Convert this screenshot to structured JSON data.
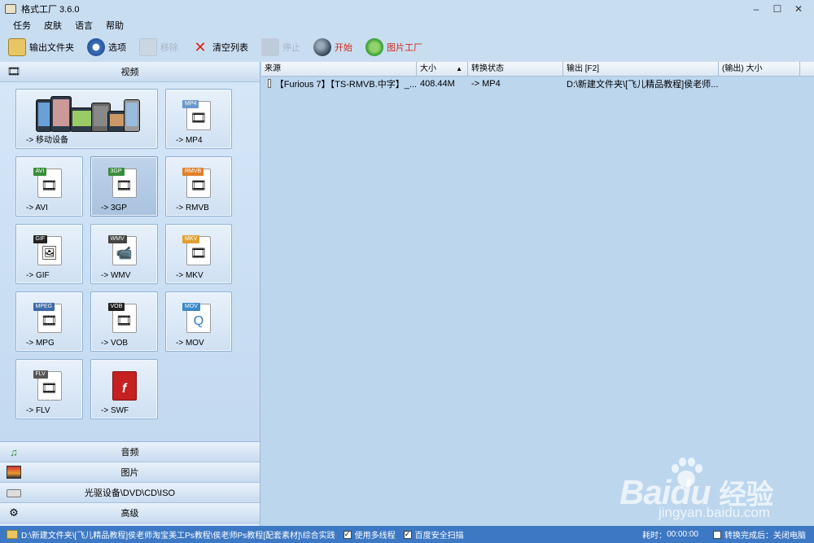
{
  "window": {
    "title": "格式工厂 3.6.0",
    "controls": [
      "–",
      "☐",
      "✕"
    ]
  },
  "menu": [
    "任务",
    "皮肤",
    "语言",
    "帮助"
  ],
  "toolbar": {
    "output_folder": "输出文件夹",
    "options": "选项",
    "remove": "移除",
    "clear_list": "清空列表",
    "stop": "停止",
    "start": "开始",
    "image_factory": "图片工厂"
  },
  "left": {
    "video_header": "视频",
    "tiles": [
      {
        "label": "-> 移动设备",
        "tag": "",
        "tag_color": ""
      },
      {
        "label": "-> MP4",
        "tag": "MP4",
        "tag_color": "#6b97c9"
      },
      {
        "label": "-> AVI",
        "tag": "AVI",
        "tag_color": "#3a8d3a"
      },
      {
        "label": "-> 3GP",
        "tag": "3GP",
        "tag_color": "#3a8d3a"
      },
      {
        "label": "-> RMVB",
        "tag": "RMVB",
        "tag_color": "#e0802a"
      },
      {
        "label": "-> GIF",
        "tag": "GIF",
        "tag_color": "#222222"
      },
      {
        "label": "-> WMV",
        "tag": "WMV",
        "tag_color": "#444444"
      },
      {
        "label": "-> MKV",
        "tag": "MKV",
        "tag_color": "#e0a030"
      },
      {
        "label": "-> MPG",
        "tag": "MPEG",
        "tag_color": "#3c6aa8"
      },
      {
        "label": "-> VOB",
        "tag": "VOB",
        "tag_color": "#222222"
      },
      {
        "label": "-> MOV",
        "tag": "MOV",
        "tag_color": "#3c8ac8"
      },
      {
        "label": "-> FLV",
        "tag": "FLV",
        "tag_color": "#555555"
      },
      {
        "label": "-> SWF",
        "tag": "SWF",
        "tag_color": "#c62020"
      }
    ],
    "audio": "音频",
    "picture": "图片",
    "rom": "光驱设备\\DVD\\CD\\ISO",
    "advanced": "高级"
  },
  "table": {
    "headers": [
      "来源",
      "大小",
      "转换状态",
      "输出 [F2]",
      "(输出) 大小"
    ],
    "rows": [
      {
        "source": "【Furious 7】【TS-RMVB.中字】_...",
        "size": "408.44M",
        "status": "-> MP4",
        "output": "D:\\新建文件夹\\[飞儿精品教程]侯老师...",
        "out_size": ""
      }
    ]
  },
  "watermark": {
    "brand": "Bai",
    "brand2": "du",
    "cn": "经验",
    "url": "jingyan.baidu.com"
  },
  "status": {
    "path": "D:\\新建文件夹\\[飞儿精品教程]侯老师淘宝美工Ps教程\\侯老师Ps教程[配套素材]\\综合实践",
    "multithread": "使用多线程",
    "baidu_scan": "百度安全扫描",
    "elapsed_label": "耗时：",
    "elapsed": "00:00:00",
    "after_done": "转换完成后：关闭电脑"
  }
}
